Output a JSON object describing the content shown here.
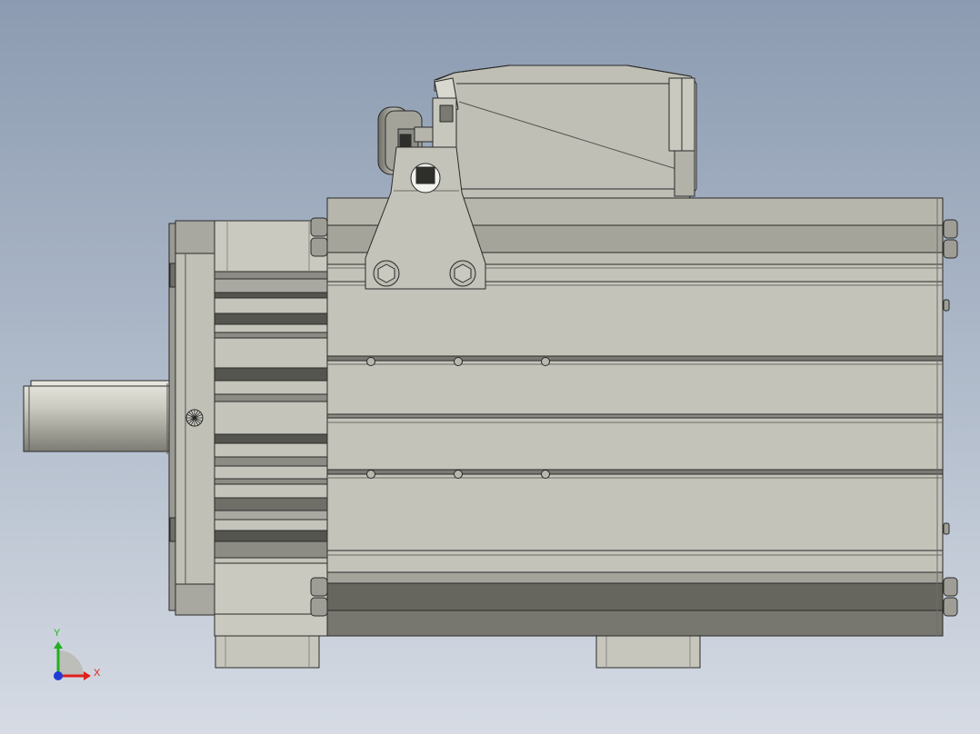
{
  "viewport": {
    "background_top": "#8c9bb1",
    "background_bottom": "#d6dbe4"
  },
  "model": {
    "body_color": "#c3c3b9",
    "dark_band_color": "#66665f",
    "edge_color": "#2a2a2a"
  },
  "triad": {
    "x_label": "X",
    "y_label": "Y",
    "x_color": "#e0201c",
    "y_color": "#22b022",
    "z_color": "#1f3cd6"
  }
}
